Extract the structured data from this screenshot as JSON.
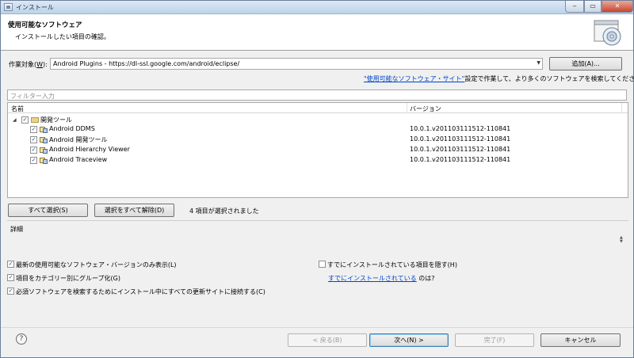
{
  "window": {
    "title": "インストール"
  },
  "header": {
    "title": "使用可能なソフトウェア",
    "subtitle": "インストールしたい項目の確認。"
  },
  "work_with": {
    "label_prefix": "作業対象(",
    "label_key": "W",
    "label_suffix": "):",
    "value": "Android Plugins - https://dl-ssl.google.com/android/eclipse/",
    "add_button": "追加(A)..."
  },
  "available_sites": {
    "link": "\"使用可能なソフトウェア・サイト\"",
    "text": "設定で作業して、より多くのソフトウェアを検索してください。"
  },
  "filter": {
    "placeholder": "フィルター入力"
  },
  "table": {
    "columns": [
      "名前",
      "バージョン"
    ],
    "group": {
      "name": "開発ツール",
      "checked": true,
      "expanded": true
    },
    "rows": [
      {
        "name": "Android DDMS",
        "version": "10.0.1.v201103111512-110841",
        "checked": true
      },
      {
        "name": "Android 開発ツール",
        "version": "10.0.1.v201103111512-110841",
        "checked": true
      },
      {
        "name": "Android Hierarchy Viewer",
        "version": "10.0.1.v201103111512-110841",
        "checked": true
      },
      {
        "name": "Android Traceview",
        "version": "10.0.1.v201103111512-110841",
        "checked": true
      }
    ]
  },
  "selection": {
    "select_all": "すべて選択(S)",
    "deselect_all": "選択をすべて解除(D)",
    "status": "4 項目が選択されました"
  },
  "details": {
    "label": "詳細"
  },
  "options": {
    "latest_only": "最新の使用可能なソフトウェア・バージョンのみ表示(L)",
    "group_by_category": "項目をカテゴリー別にグループ化(G)",
    "contact_sites": "必須ソフトウェアを検索するためにインストール中にすべての更新サイトに接続する(C)",
    "hide_installed": "すでにインストールされている項目を隠す(H)",
    "installed_link": "すでにインストールされている",
    "installed_suffix": "のは?"
  },
  "option_states": {
    "latest_only": true,
    "group_by_category": true,
    "contact_sites": true,
    "hide_installed": false
  },
  "footer": {
    "back": "< 戻る(B)",
    "next": "次へ(N) >",
    "finish": "完了(F)",
    "cancel": "キャンセル"
  },
  "icons": {
    "help": "help-icon",
    "header": "install-wizard-icon",
    "group": "folder-icon",
    "feature": "plugin-feature-icon"
  }
}
